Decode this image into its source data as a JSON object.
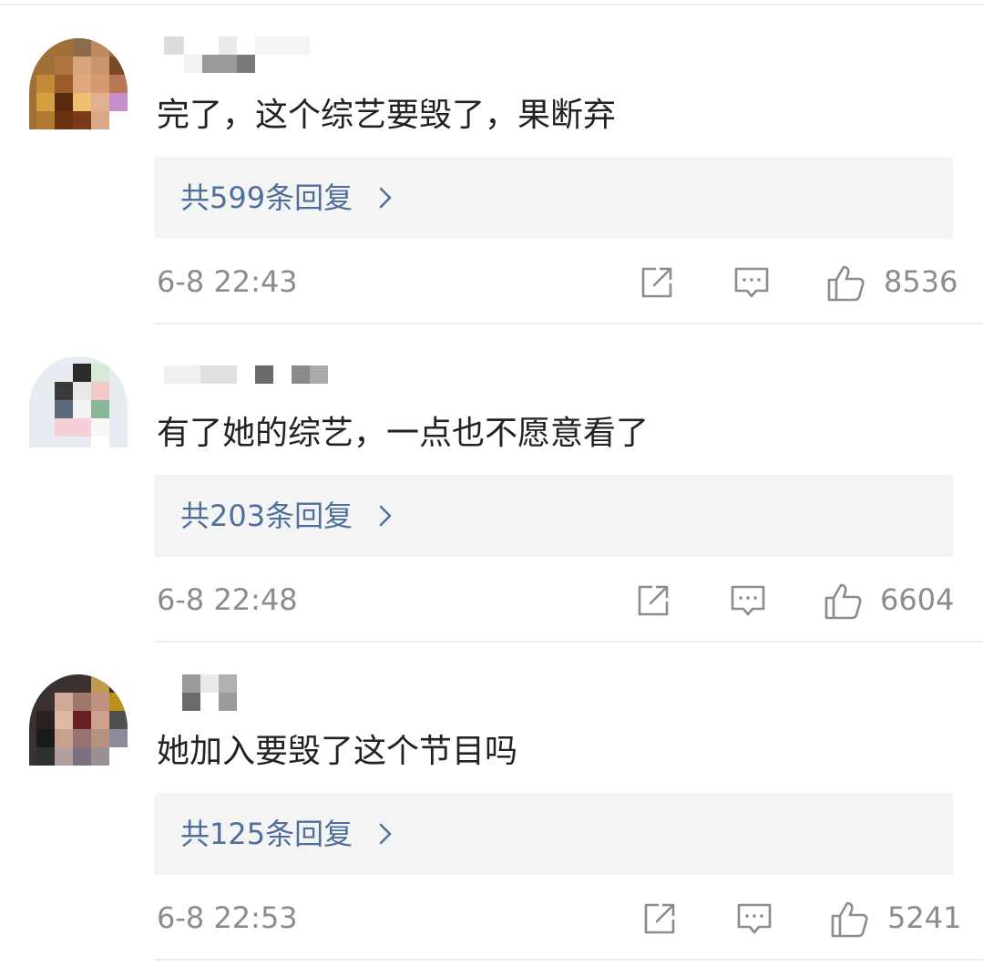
{
  "comments": [
    {
      "text": "完了，这个综艺要毁了，果断弃",
      "replies_label": "共599条回复",
      "time": "6-8 22:43",
      "likes": "8536"
    },
    {
      "text": "有了她的综艺，一点也不愿意看了",
      "replies_label": "共203条回复",
      "time": "6-8 22:48",
      "likes": "6604"
    },
    {
      "text": "她加入要毁了这个节目吗",
      "replies_label": "共125条回复",
      "time": "6-8 22:53",
      "likes": "5241"
    }
  ],
  "icons": {
    "share": "share-icon",
    "reply": "comment-icon",
    "like": "thumbs-up-icon",
    "more": "chevron-right-icon"
  },
  "colors": {
    "reply_link": "#4f6f9a",
    "reply_box_bg": "#f4f4f4",
    "meta_text": "#8c8c8c",
    "comment_text": "#222222"
  }
}
